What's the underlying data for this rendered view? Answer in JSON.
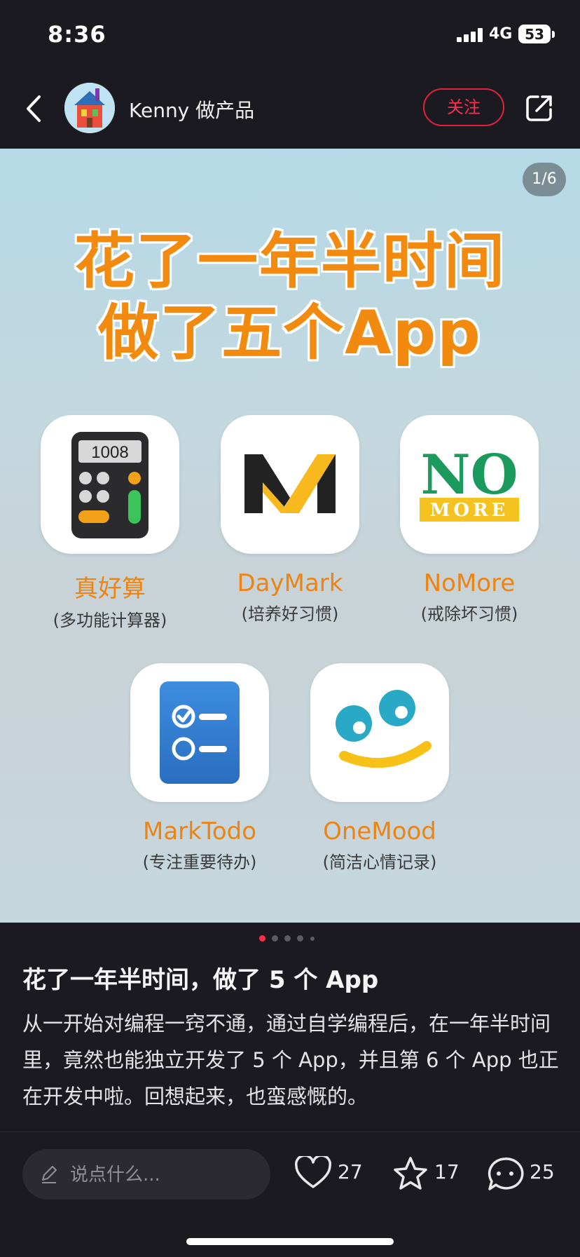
{
  "status_bar": {
    "time": "8:36",
    "network": "4G",
    "battery": "53"
  },
  "header": {
    "username": "Kenny 做产品",
    "follow_label": "关注",
    "icons": [
      "back-icon",
      "avatar",
      "share-icon"
    ]
  },
  "carousel": {
    "counter": "1/6",
    "headline_line1": "花了一年半时间",
    "headline_line2": "做了五个App",
    "apps": [
      {
        "name": "真好算",
        "desc": "(多功能计算器)",
        "icon_text": "1008",
        "icon": "calculator-icon"
      },
      {
        "name": "DayMark",
        "desc": "(培养好习惯)",
        "icon": "daymark-m-icon"
      },
      {
        "name": "NoMore",
        "desc": "(戒除坏习惯)",
        "icon_text_main": "NO",
        "icon_text_sub": "MORE",
        "icon": "nomore-icon"
      },
      {
        "name": "MarkTodo",
        "desc": "(专注重要待办)",
        "icon": "todo-checklist-icon"
      },
      {
        "name": "OneMood",
        "desc": "(简洁心情记录)",
        "icon": "smiley-face-icon"
      }
    ],
    "page_dots": 5,
    "active_dot": 0,
    "colors": {
      "headline": "#f18a0e",
      "app_name": "#ec8413"
    }
  },
  "post": {
    "title": "花了一年半时间，做了 5 个 App",
    "body": "从一开始对编程一窍不通，通过自学编程后，在一年半时间里，竟然也能独立开发了 5 个 App，并且第 6 个 App 也正在开发中啦。回想起来，也蛮感慨的。"
  },
  "bottom_bar": {
    "comment_placeholder": "说点什么...",
    "likes": "27",
    "favorites": "17",
    "comments": "25",
    "icons": [
      "pen-icon",
      "heart-icon",
      "star-icon",
      "comment-bubble-icon"
    ]
  },
  "colors": {
    "accent": "#ff2d4d",
    "background": "#1b1a20"
  }
}
